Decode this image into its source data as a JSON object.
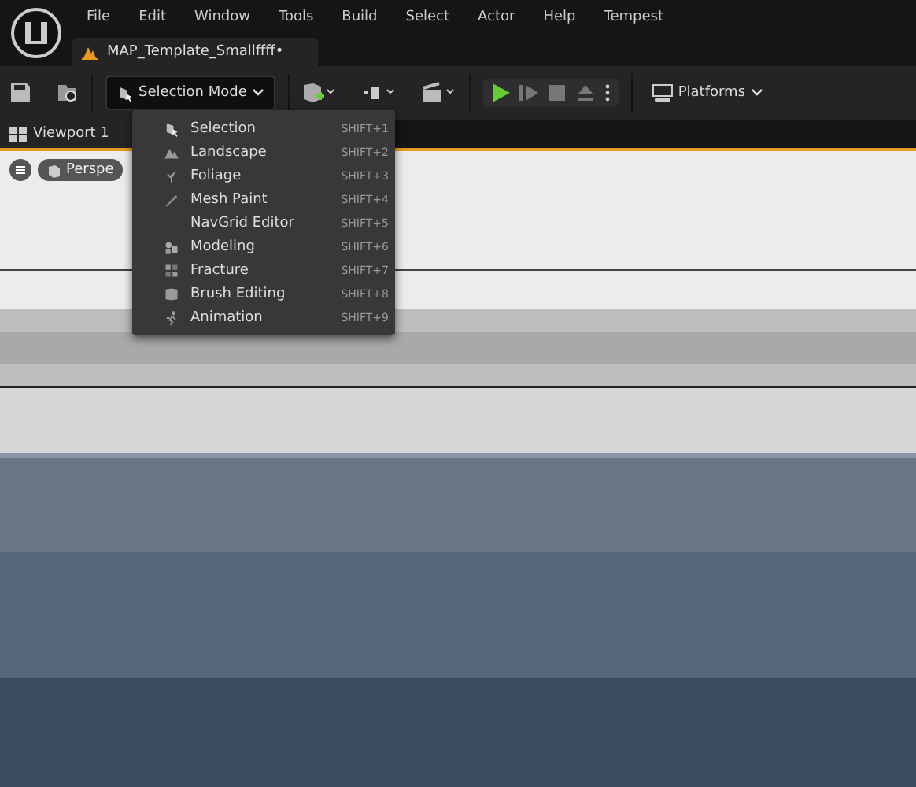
{
  "menu_bar": [
    "File",
    "Edit",
    "Window",
    "Tools",
    "Build",
    "Select",
    "Actor",
    "Help",
    "Tempest"
  ],
  "document_tab": {
    "title": "MAP_Template_Smallffff•"
  },
  "toolbar": {
    "mode_button": "Selection Mode",
    "platforms_button": "Platforms"
  },
  "viewport_tab": {
    "title": "Viewport 1"
  },
  "viewport": {
    "perspective_button": "Perspe"
  },
  "mode_menu": [
    {
      "label": "Selection",
      "shortcut": "SHIFT+1"
    },
    {
      "label": "Landscape",
      "shortcut": "SHIFT+2"
    },
    {
      "label": "Foliage",
      "shortcut": "SHIFT+3"
    },
    {
      "label": "Mesh Paint",
      "shortcut": "SHIFT+4"
    },
    {
      "label": "NavGrid Editor",
      "shortcut": "SHIFT+5"
    },
    {
      "label": "Modeling",
      "shortcut": "SHIFT+6"
    },
    {
      "label": "Fracture",
      "shortcut": "SHIFT+7"
    },
    {
      "label": "Brush Editing",
      "shortcut": "SHIFT+8"
    },
    {
      "label": "Animation",
      "shortcut": "SHIFT+9"
    }
  ]
}
